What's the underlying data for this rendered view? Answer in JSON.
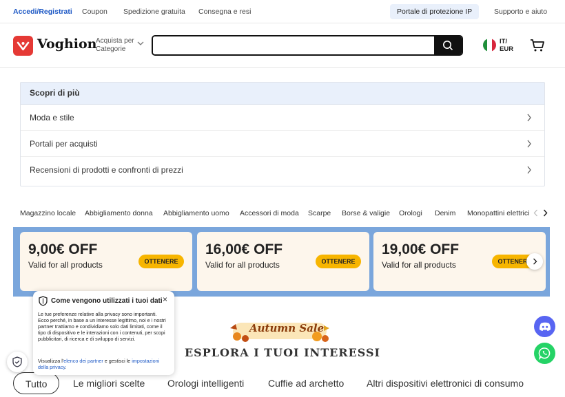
{
  "topbar": {
    "login": "Accedi/Registrati",
    "links": [
      "Coupon",
      "Spedizione gratuita",
      "Consegna e resi"
    ],
    "ip_portal": "Portale di protezione IP",
    "support": "Supporto e aiuto"
  },
  "header": {
    "brand": "Voghion",
    "categories_line1": "Acquista per",
    "categories_line2": "Categorie",
    "search_placeholder": "",
    "locale_lang": "IT/",
    "locale_currency": "EUR"
  },
  "discover": {
    "heading": "Scopri di più",
    "items": [
      "Moda e stile",
      "Portali per acquisti",
      "Recensioni di prodotti e confronti di prezzi"
    ]
  },
  "category_strip": [
    "Magazzino locale",
    "Abbigliamento donna",
    "Abbigliamento uomo",
    "Accessori di moda",
    "Scarpe",
    "Borse & valigie",
    "Orologi",
    "Denim",
    "Monopattini elettrici"
  ],
  "coupons": [
    {
      "amount": "9,00€ OFF",
      "desc": "Valid for all products",
      "button": "OTTENERE"
    },
    {
      "amount": "16,00€ OFF",
      "desc": "Valid for all products",
      "button": "OTTENERE"
    },
    {
      "amount": "19,00€ OFF",
      "desc": "Valid for all products",
      "button": "OTTENERE"
    }
  ],
  "banner": {
    "autumn": "Autumn Sale",
    "heading": "ESPLORA I TUOI INTERESSI"
  },
  "tabs": [
    "Tutto",
    "Le migliori scelte",
    "Orologi intelligenti",
    "Cuffie ad archetto",
    "Altri dispositivi elettronici di consumo"
  ],
  "privacy": {
    "title": "Come vengono utilizzati i tuoi dati",
    "close": "×",
    "body": "Le tue preferenze relative alla privacy sono importanti. Ecco perché, in base a un interesse legittimo, noi e i nostri partner trattiamo e condividiamo solo dati limitati, come il tipo di dispositivo e le interazioni con i contenuti, per scopi pubblicitari, di ricerca e di sviluppo di servizi.",
    "footer_prefix": "Visualizza l'",
    "partners_link": "elenco dei partner",
    "footer_mid": " e gestisci le ",
    "settings_link": "impostazioni della privacy",
    "footer_suffix": "."
  },
  "colors": {
    "brand_red": "#e53935",
    "link_blue": "#1a56c4",
    "coupon_band": "#7aa6dc",
    "coupon_button": "#f7b500",
    "discord": "#5865f2",
    "whatsapp": "#25d366"
  },
  "icons": [
    "logo-icon",
    "chevron-down-icon",
    "search-icon",
    "italy-flag-icon",
    "cart-icon",
    "chevron-right-icon",
    "chevron-left-icon",
    "shield-icon",
    "close-icon",
    "discord-icon",
    "whatsapp-icon"
  ]
}
